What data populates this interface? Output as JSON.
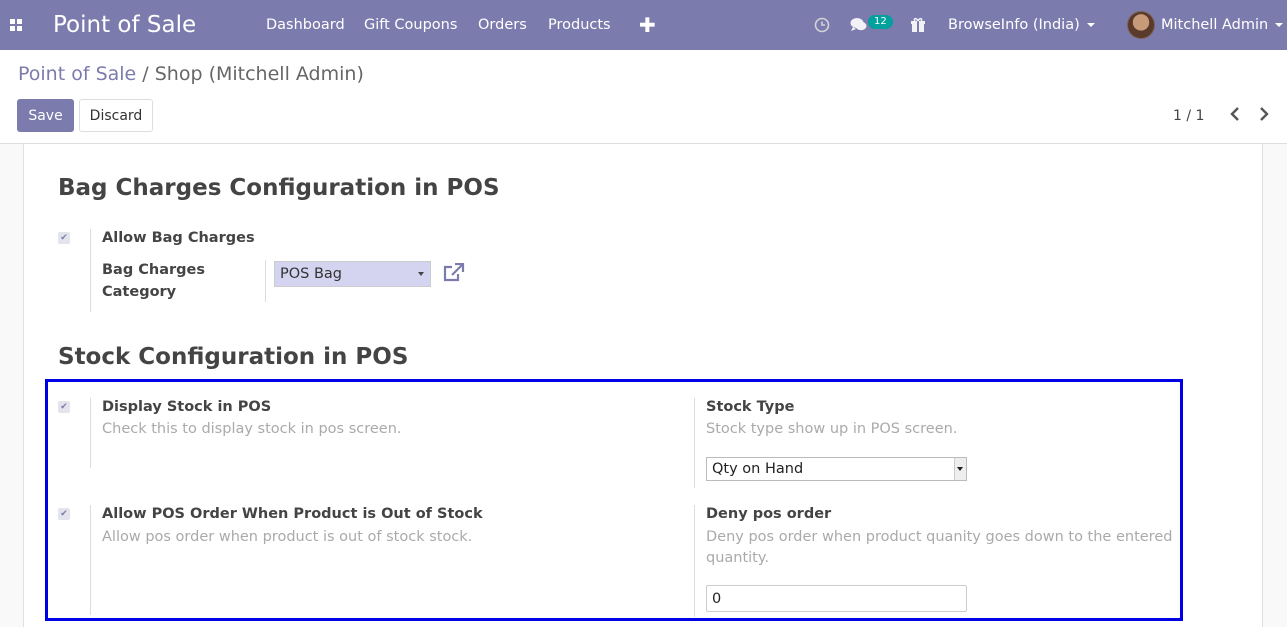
{
  "navbar": {
    "app_title": "Point of Sale",
    "menu": [
      "Dashboard",
      "Gift Coupons",
      "Orders",
      "Products"
    ],
    "add_glyph": "✚",
    "chat_badge": "12",
    "company": "BrowseInfo (India)",
    "user": "Mitchell Admin",
    "colors": {
      "bar": "#7c7bad",
      "badge": "#00a09d"
    }
  },
  "breadcrumb": {
    "parent": "Point of Sale",
    "separator": "/",
    "current": "Shop (Mitchell Admin)"
  },
  "actions": {
    "save": "Save",
    "discard": "Discard"
  },
  "pager": {
    "text": "1 / 1"
  },
  "bag_section": {
    "title": "Bag Charges Configuration in POS",
    "allow_bag_label": "Allow Bag Charges",
    "allow_bag_checked": true,
    "category_label_1": "Bag Charges",
    "category_label_2": "Category",
    "category_value": "POS Bag"
  },
  "stock_section": {
    "title": "Stock Configuration in POS",
    "display_stock_label": "Display Stock in POS",
    "display_stock_help": "Check this to display stock in pos screen.",
    "display_stock_checked": true,
    "stock_type_label": "Stock Type",
    "stock_type_help": "Stock type show up in POS screen.",
    "stock_type_value": "Qty on Hand",
    "allow_order_label": "Allow POS Order When Product is Out of Stock",
    "allow_order_help": "Allow pos order when product is out of stock stock.",
    "allow_order_checked": true,
    "deny_label": "Deny pos order",
    "deny_help_1": "Deny pos order when product quanity goes down to the entered",
    "deny_help_2": "quantity.",
    "deny_value": "0",
    "highlight_color": "#0000e6"
  }
}
